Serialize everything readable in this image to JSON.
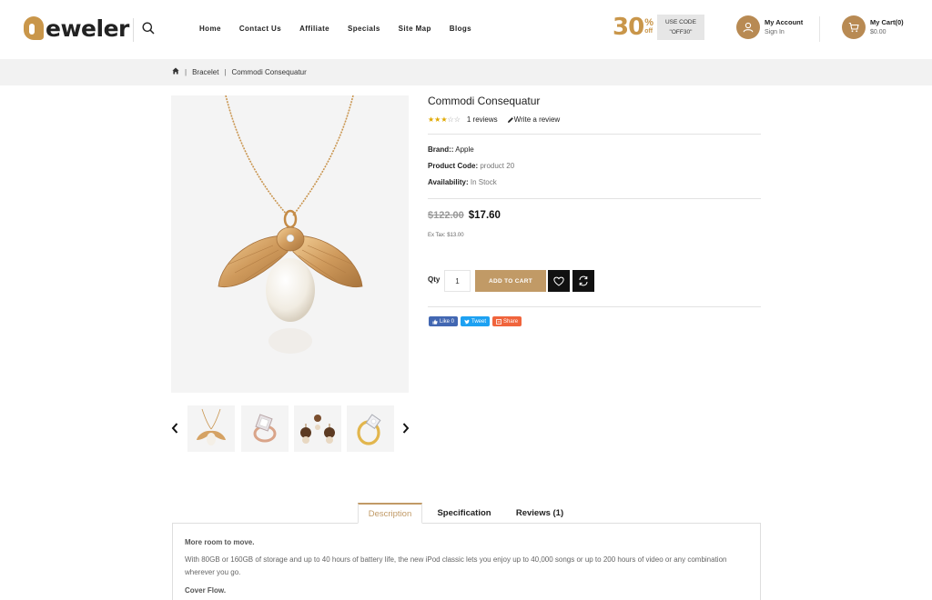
{
  "header": {
    "logo_text": "eweler",
    "nav": [
      "Home",
      "Contact Us",
      "Affiliate",
      "Specials",
      "Site Map",
      "Blogs"
    ],
    "promo": {
      "number": "30",
      "percent": "%",
      "off": "off",
      "code_label": "USE CODE",
      "code_value": "\"OFF30\""
    },
    "account": {
      "title": "My Account",
      "subtitle": "Sign In"
    },
    "cart": {
      "title": "My Cart(0)",
      "subtitle": "$0.00"
    }
  },
  "breadcrumb": {
    "items": [
      "Bracelet",
      "Commodi Consequatur"
    ]
  },
  "product": {
    "title": "Commodi Consequatur",
    "rating": 3,
    "rating_max": 5,
    "reviews_link": "1 reviews",
    "write_review": "Write a review",
    "brand_label": "Brand::",
    "brand_value": "Apple",
    "code_label": "Product Code:",
    "code_value": "product 20",
    "availability_label": "Availability:",
    "availability_value": "In Stock",
    "old_price": "$122.00",
    "new_price": "$17.60",
    "ex_tax": "Ex Tax: $13.00",
    "qty_label": "Qty",
    "qty_value": "1",
    "add_to_cart": "ADD TO CART",
    "share": {
      "like": "Like 0",
      "tweet": "Tweet",
      "share": "Share"
    }
  },
  "tabs": {
    "items": [
      "Description",
      "Specification",
      "Reviews (1)"
    ],
    "active": "Description"
  },
  "description": {
    "heading1": "More room to move.",
    "para1": "With 80GB or 160GB of storage and up to 40 hours of battery life, the new iPod classic lets you enjoy up to 40,000 songs or up to 200 hours of video or any combination wherever you go.",
    "heading2": "Cover Flow."
  },
  "colors": {
    "accent": "#c19a66",
    "promo_gold": "#c9964a",
    "star": "#e0a800"
  }
}
